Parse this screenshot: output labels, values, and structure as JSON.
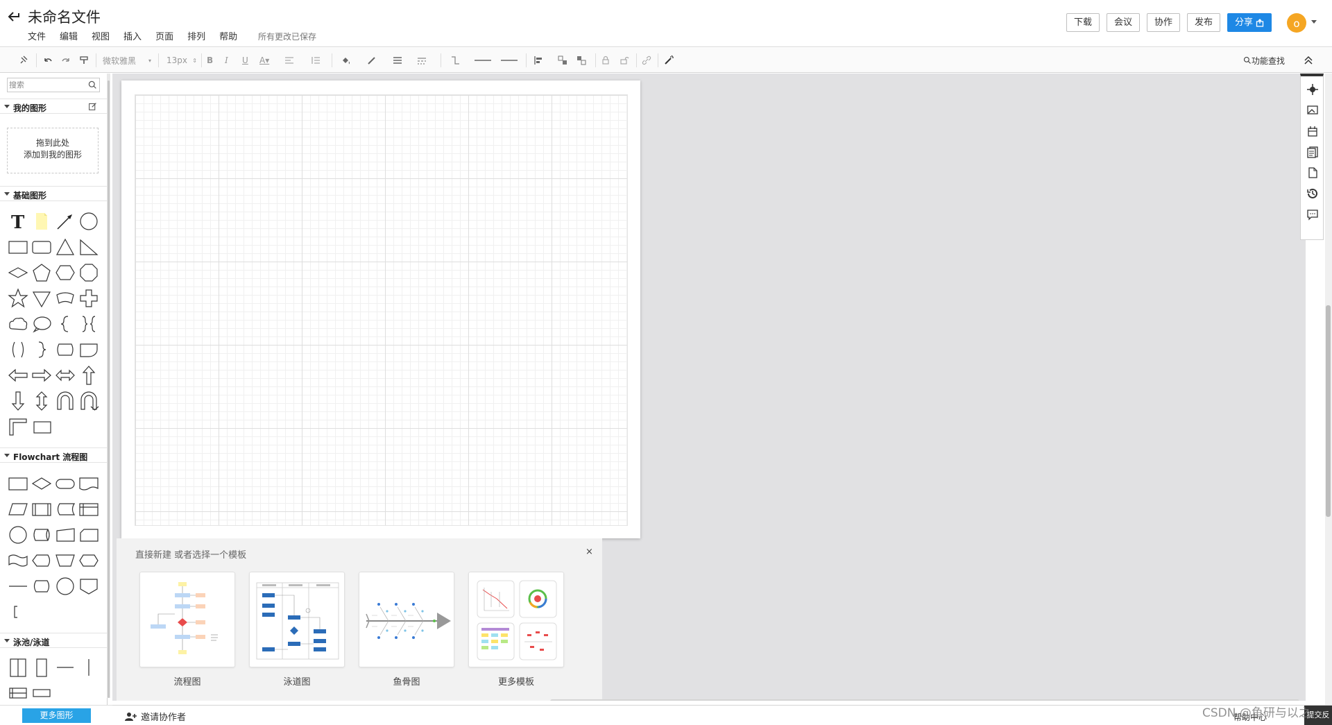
{
  "header": {
    "title": "未命名文件",
    "menu": [
      "文件",
      "编辑",
      "视图",
      "插入",
      "页面",
      "排列",
      "帮助"
    ],
    "save_status": "所有更改已保存",
    "buttons": {
      "download": "下载",
      "meeting": "会议",
      "collaborate": "协作",
      "publish": "发布",
      "share": "分享"
    },
    "avatar_initial": "o"
  },
  "toolbar": {
    "font_family": "微软雅黑",
    "font_size": "13px",
    "feature_search": "功能查找"
  },
  "sidebar": {
    "search_placeholder": "搜索",
    "sections": {
      "my_shapes": "我的图形",
      "basic": "基础图形",
      "flowchart": "Flowchart 流程图",
      "swimlane": "泳池/泳道"
    },
    "drop_zone": {
      "line1": "拖到此处",
      "line2": "添加到我的图形"
    },
    "more_shapes": "更多图形"
  },
  "templates": {
    "prompt": "直接新建 或者选择一个模板",
    "close_glyph": "×",
    "items": [
      "流程图",
      "泳道图",
      "鱼骨图",
      "更多模板"
    ]
  },
  "bottom": {
    "invite": "邀请协作者",
    "help_center": "帮助中心",
    "feedback": "提交反馈"
  },
  "watermark": "CSDN @鱼研与以之",
  "colors": {
    "accent": "#1e88e5",
    "avatar": "#f5a623",
    "more_shapes": "#29a3e6",
    "canvas_bg": "#e1e1e3"
  }
}
